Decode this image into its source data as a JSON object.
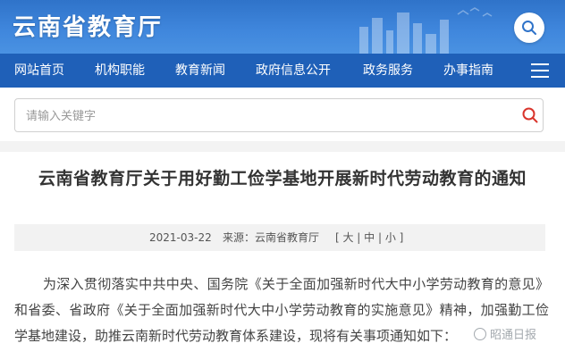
{
  "header": {
    "site_title": "云南省教育厅",
    "search_icon": "search-icon"
  },
  "nav": {
    "items": [
      "网站首页",
      "机构职能",
      "教育新闻",
      "政府信息公开",
      "政务服务",
      "办事指南"
    ],
    "menu_icon": "menu-icon"
  },
  "search": {
    "placeholder": "请输入关键字",
    "icon": "search-icon",
    "accent_color": "#d9342b"
  },
  "article": {
    "title": "云南省教育厅关于用好勤工俭学基地开展新时代劳动教育的通知",
    "date": "2021-03-22",
    "source": "来源：云南省教育厅",
    "font_size_label": "[ 大 | 中 | 小 ]",
    "body": "为深入贯彻落实中共中央、国务院《关于全面加强新时代大中小学劳动教育的意见》和省委、省政府《关于全面加强新时代大中小学劳动教育的实施意见》精神，加强勤工俭学基地建设，助推云南新时代劳动教育体系建设，现将有关事项通知如下："
  },
  "watermark": {
    "text": "昭通日报"
  },
  "colors": {
    "banner": "#3f86dc",
    "nav": "#1f60b8",
    "meta_bg": "#f2f2f2"
  }
}
